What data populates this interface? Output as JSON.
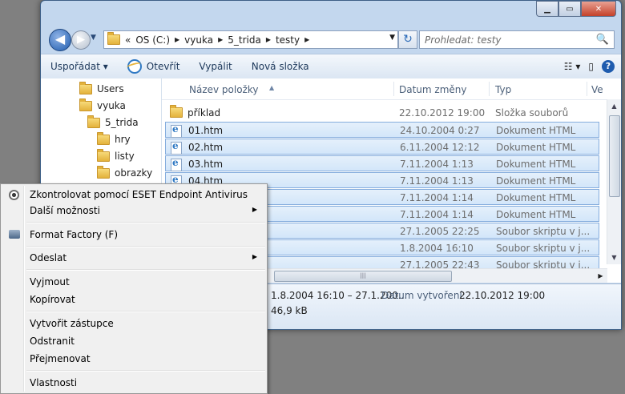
{
  "window": {
    "controls": {
      "minimize": "▁",
      "maximize": "▭",
      "close": "✕"
    }
  },
  "nav": {
    "back": "◀",
    "forward": "▶",
    "history": "▼"
  },
  "address": {
    "overflow": "«",
    "crumbs": [
      "OS (C:)",
      "vyuka",
      "5_trida",
      "testy"
    ],
    "separator": "▶",
    "dropdown": "▼"
  },
  "refresh": "↻",
  "search": {
    "placeholder": "Prohledat: testy",
    "icon": "🔍"
  },
  "toolbar": {
    "organize": "Uspořádat ▾",
    "open": "Otevřít",
    "burn": "Vypálit",
    "new_folder": "Nová složka",
    "views": "☷ ▾",
    "preview": "▯",
    "help": "?"
  },
  "tree": [
    {
      "label": "Users"
    },
    {
      "label": "vyuka"
    },
    {
      "label": "5_trida"
    },
    {
      "label": "hry"
    },
    {
      "label": "listy"
    },
    {
      "label": "obrazky"
    }
  ],
  "columns": {
    "name": "Název položky",
    "date": "Datum změny",
    "type": "Typ",
    "size": "Ve"
  },
  "rows": [
    {
      "name": "příklad",
      "date": "22.10.2012 19:00",
      "type": "Složka souborů",
      "icon": "folder-icon",
      "selected": false
    },
    {
      "name": "01.htm",
      "date": "24.10.2004 0:27",
      "type": "Dokument HTML",
      "icon": "htm-file-icon",
      "selected": true
    },
    {
      "name": "02.htm",
      "date": "6.11.2004 12:12",
      "type": "Dokument HTML",
      "icon": "htm-file-icon",
      "selected": true
    },
    {
      "name": "03.htm",
      "date": "7.11.2004 1:13",
      "type": "Dokument HTML",
      "icon": "htm-file-icon",
      "selected": true
    },
    {
      "name": "04.htm",
      "date": "7.11.2004 1:13",
      "type": "Dokument HTML",
      "icon": "htm-file-icon",
      "selected": true
    },
    {
      "name": "",
      "date": "7.11.2004 1:14",
      "type": "Dokument HTML",
      "icon": "",
      "selected": true
    },
    {
      "name": "",
      "date": "7.11.2004 1:14",
      "type": "Dokument HTML",
      "icon": "",
      "selected": true
    },
    {
      "name": "",
      "date": "27.1.2005 22:25",
      "type": "Soubor skriptu v j...",
      "icon": "",
      "selected": true
    },
    {
      "name": "",
      "date": "1.8.2004 16:10",
      "type": "Soubor skriptu v j...",
      "icon": "",
      "selected": true
    },
    {
      "name": "",
      "date": "27.1.2005 22:43",
      "type": "Soubor skriptu v j...",
      "icon": "",
      "selected": true
    }
  ],
  "details": {
    "date_range": "1.8.2004 16:10 – 27.1.200...",
    "created_label": "Datum vytvoření:",
    "created_value": "22.10.2012 19:00",
    "size": "46,9 kB"
  },
  "context_menu": {
    "items": [
      {
        "label": "Zkontrolovat pomocí ESET Endpoint Antivirus",
        "icon": "eset-icon"
      },
      {
        "label": "Další možnosti",
        "submenu": true
      },
      {
        "label": "Format Factory (F)",
        "icon": "format-factory-icon"
      },
      {
        "label": "Odeslat",
        "submenu": true
      },
      {
        "label": "Vyjmout"
      },
      {
        "label": "Kopírovat"
      },
      {
        "label": "Vytvořit zástupce"
      },
      {
        "label": "Odstranit"
      },
      {
        "label": "Přejmenovat"
      },
      {
        "label": "Vlastnosti"
      }
    ],
    "submenu_arrow": "▶"
  },
  "scroll": {
    "up": "▲",
    "down": "▼",
    "right": "▶",
    "grip": "|||"
  }
}
